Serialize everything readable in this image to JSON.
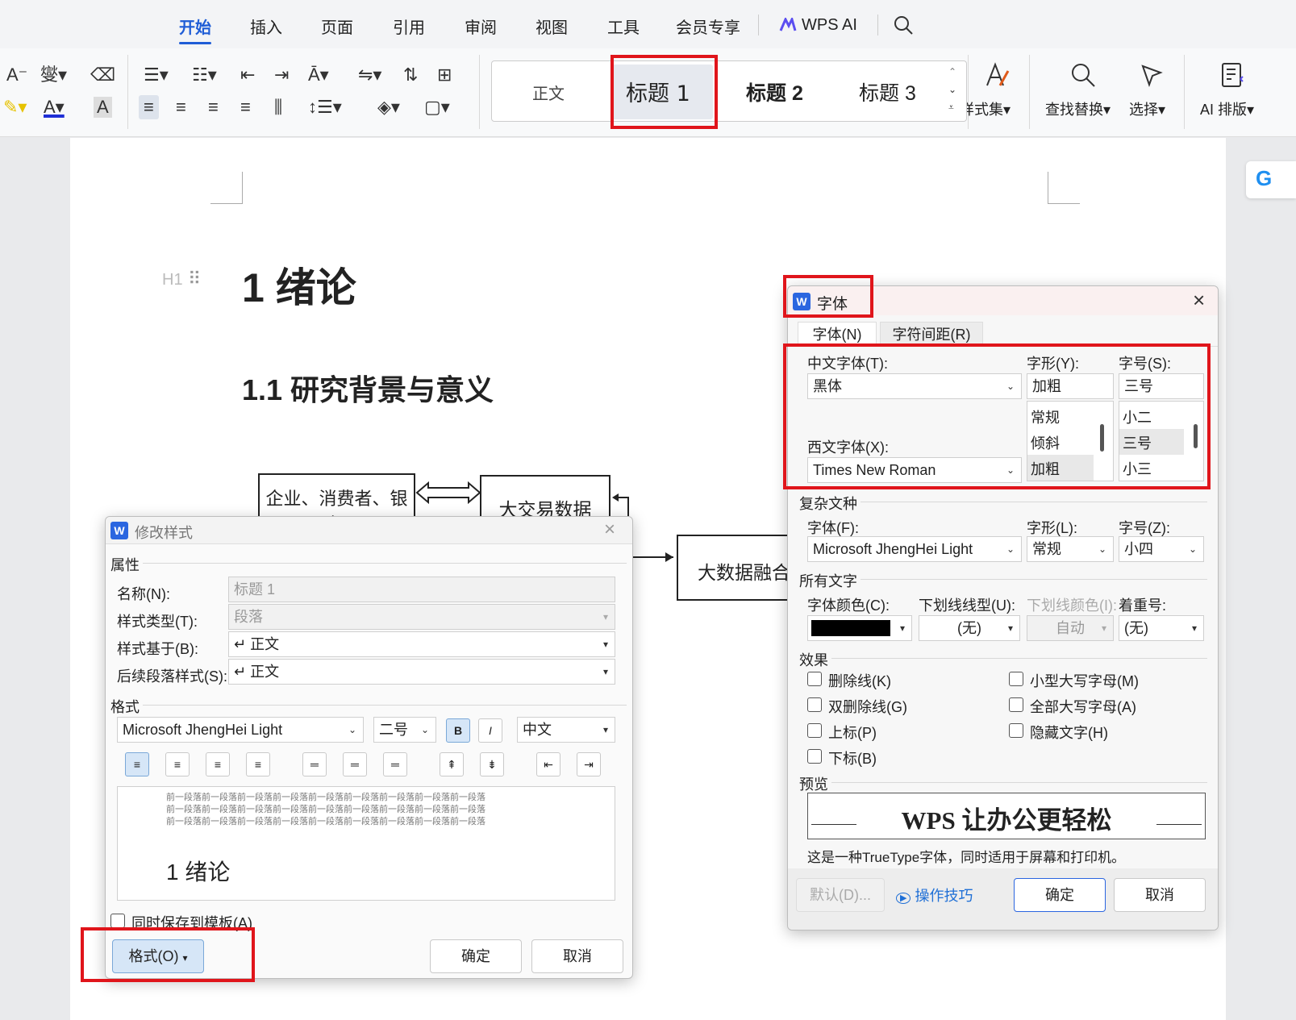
{
  "menu_tabs": [
    "开始",
    "插入",
    "页面",
    "引用",
    "审阅",
    "视图",
    "工具",
    "会员专享"
  ],
  "wps_ai_label": "WPS AI",
  "style_gallery": {
    "normal": "正文",
    "h1": "标题 1",
    "h2": "标题 2",
    "h3": "标题 3",
    "styles_label": "样式集"
  },
  "ribbon_right": {
    "find_replace": "查找替换",
    "select": "选择",
    "ai_layout": "AI 排版"
  },
  "doc": {
    "h1_marker": "H1",
    "heading1": "1 绪论",
    "heading2": "1.1 研究背景与意义",
    "box1": "企业、消费者、银行",
    "box2": "大交易数据",
    "box3": "大数据融合"
  },
  "modify_style": {
    "title": "修改样式",
    "props_section": "属性",
    "name_label": "名称(N):",
    "name_value": "标题 1",
    "type_label": "样式类型(T):",
    "type_value": "段落",
    "based_label": "样式基于(B):",
    "based_value": "↵ 正文",
    "next_label": "后续段落样式(S):",
    "next_value": "↵ 正文",
    "format_section": "格式",
    "font_value": "Microsoft JhengHei Light",
    "size_value": "二号",
    "bold": "B",
    "italic": "I",
    "lang_value": "中文",
    "preview_prev": "前一段落前一段落前一段落前一段落前一段落前一段落前一段落前一段落前一段落",
    "preview_text": "1 绪论",
    "save_template": "同时保存到模板(A)",
    "format_btn": "格式(O)",
    "ok": "确定",
    "cancel": "取消"
  },
  "font_dialog": {
    "title": "字体",
    "tab_font": "字体(N)",
    "tab_spacing": "字符间距(R)",
    "cn_font_label": "中文字体(T):",
    "cn_font_value": "黑体",
    "style_label": "字形(Y):",
    "style_value": "加粗",
    "style_options": [
      "常规",
      "倾斜",
      "加粗"
    ],
    "size_label": "字号(S):",
    "size_value": "三号",
    "size_options": [
      "小二",
      "三号",
      "小三"
    ],
    "west_font_label": "西文字体(X):",
    "west_font_value": "Times New Roman",
    "complex_section": "复杂文种",
    "c_font_label": "字体(F):",
    "c_font_value": "Microsoft JhengHei Light",
    "c_style_label": "字形(L):",
    "c_style_value": "常规",
    "c_size_label": "字号(Z):",
    "c_size_value": "小四",
    "all_text_section": "所有文字",
    "color_label": "字体颜色(C):",
    "underline_label": "下划线线型(U):",
    "underline_value": "(无)",
    "uline_color_label": "下划线颜色(I):",
    "uline_color_value": "自动",
    "emphasis_label": "着重号:",
    "emphasis_value": "(无)",
    "effects_section": "效果",
    "effects_left": [
      "删除线(K)",
      "双删除线(G)",
      "上标(P)",
      "下标(B)"
    ],
    "effects_right": [
      "小型大写字母(M)",
      "全部大写字母(A)",
      "隐藏文字(H)"
    ],
    "preview_section": "预览",
    "preview_text": "WPS 让办公更轻松",
    "preview_note": "这是一种TrueType字体，同时适用于屏幕和打印机。",
    "default_btn": "默认(D)...",
    "tips": "操作技巧",
    "ok": "确定",
    "cancel": "取消"
  },
  "colors": {
    "accent": "#1f5dd6",
    "red_highlight": "#e0151b",
    "font_color": "#000000"
  }
}
